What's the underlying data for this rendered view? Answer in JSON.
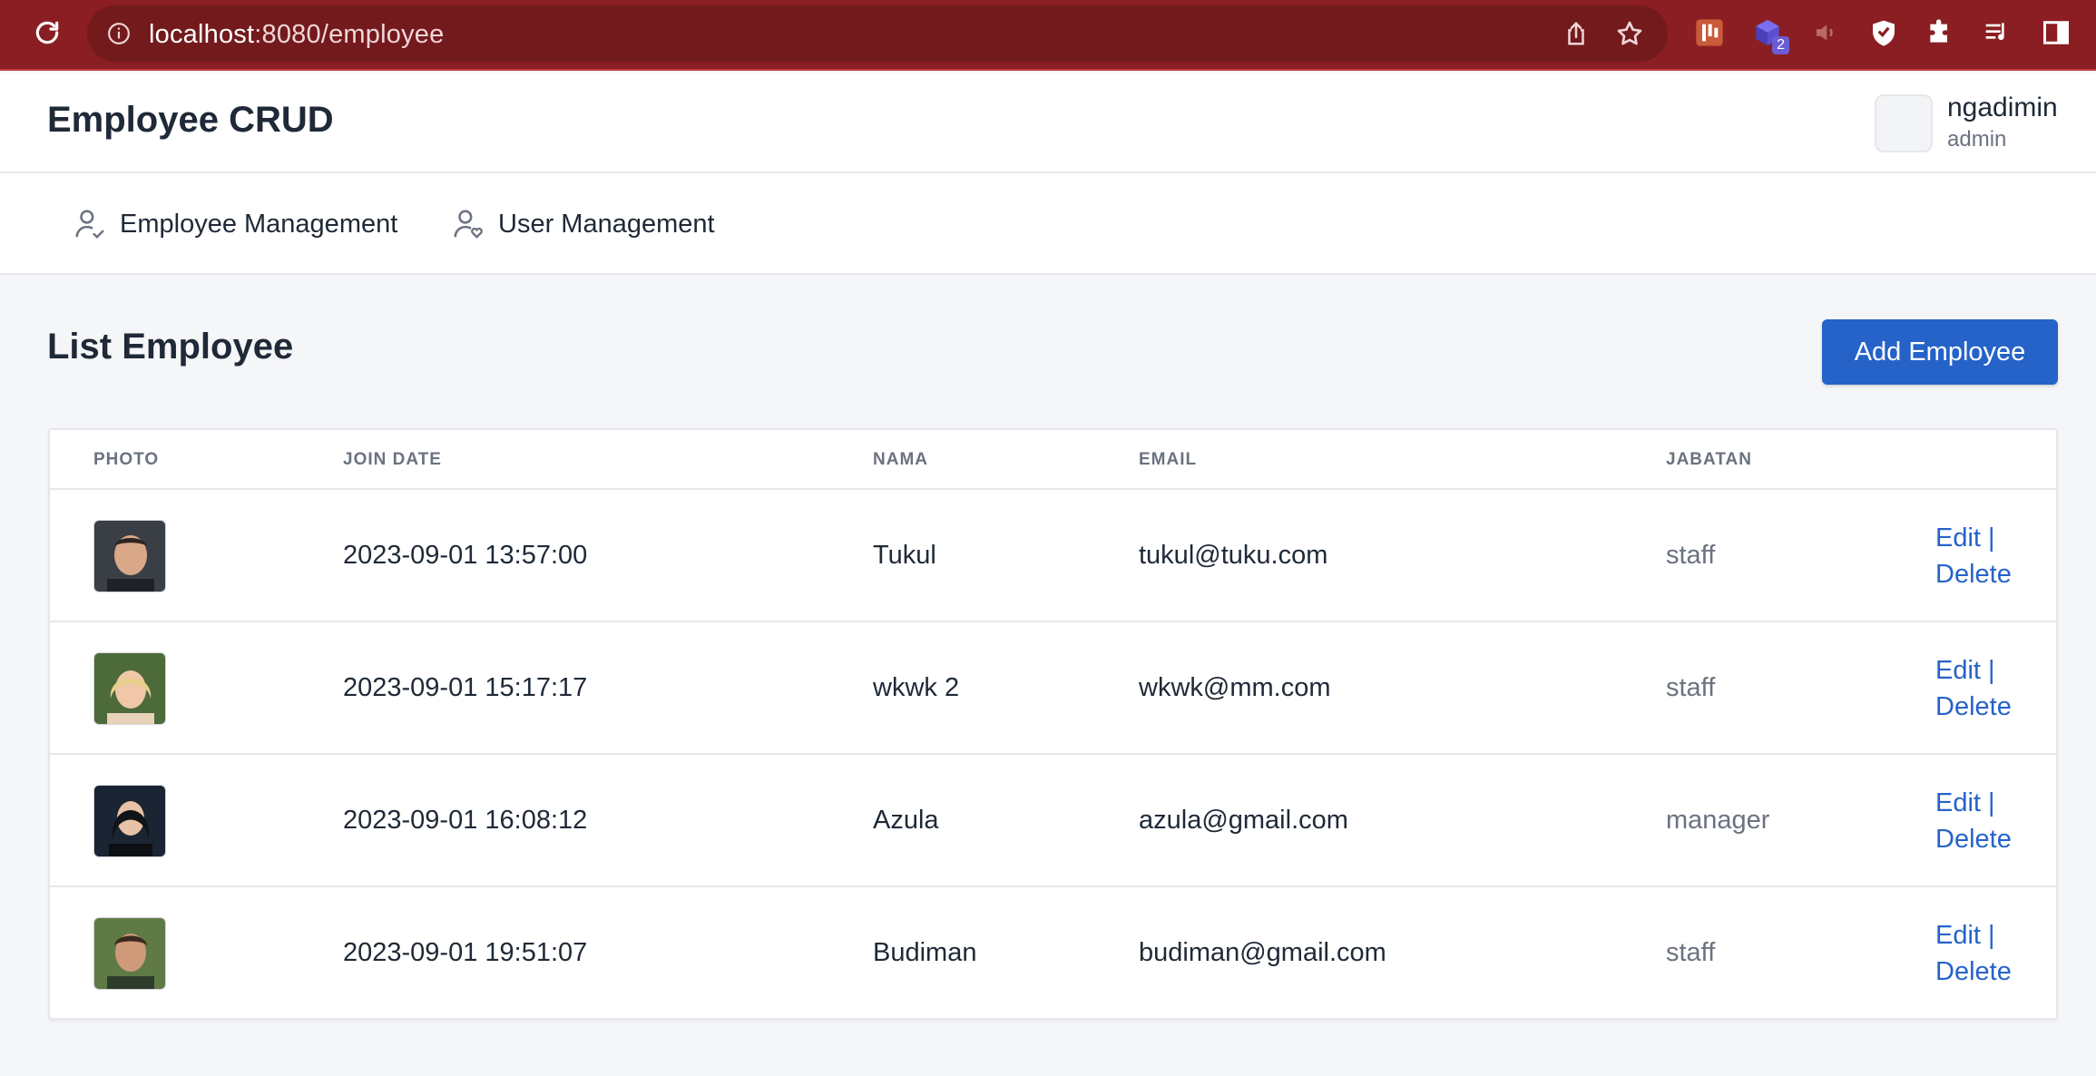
{
  "browser": {
    "url_host": "localhost",
    "url_rest": ":8080/employee",
    "extension_badge": "2"
  },
  "header": {
    "title": "Employee CRUD",
    "user_name": "ngadimin",
    "user_role": "admin"
  },
  "nav": {
    "items": [
      {
        "label": "Employee Management",
        "icon": "user-check-icon"
      },
      {
        "label": "User Management",
        "icon": "user-heart-icon"
      }
    ]
  },
  "main": {
    "title": "List Employee",
    "add_button": "Add Employee"
  },
  "table": {
    "columns": [
      "PHOTO",
      "JOIN DATE",
      "NAMA",
      "EMAIL",
      "JABATAN"
    ],
    "edit_label": "Edit",
    "delete_label": "Delete",
    "separator": "|",
    "rows": [
      {
        "join_date": "2023-09-01 13:57:00",
        "nama": "Tukul",
        "email": "tukul@tuku.com",
        "jabatan": "staff"
      },
      {
        "join_date": "2023-09-01 15:17:17",
        "nama": "wkwk 2",
        "email": "wkwk@mm.com",
        "jabatan": "staff"
      },
      {
        "join_date": "2023-09-01 16:08:12",
        "nama": "Azula",
        "email": "azula@gmail.com",
        "jabatan": "manager"
      },
      {
        "join_date": "2023-09-01 19:51:07",
        "nama": "Budiman",
        "email": "budiman@gmail.com",
        "jabatan": "staff"
      }
    ]
  },
  "colors": {
    "chrome": "#8a1e22",
    "primary": "#2563c9",
    "page_bg": "#f5f6f8"
  }
}
